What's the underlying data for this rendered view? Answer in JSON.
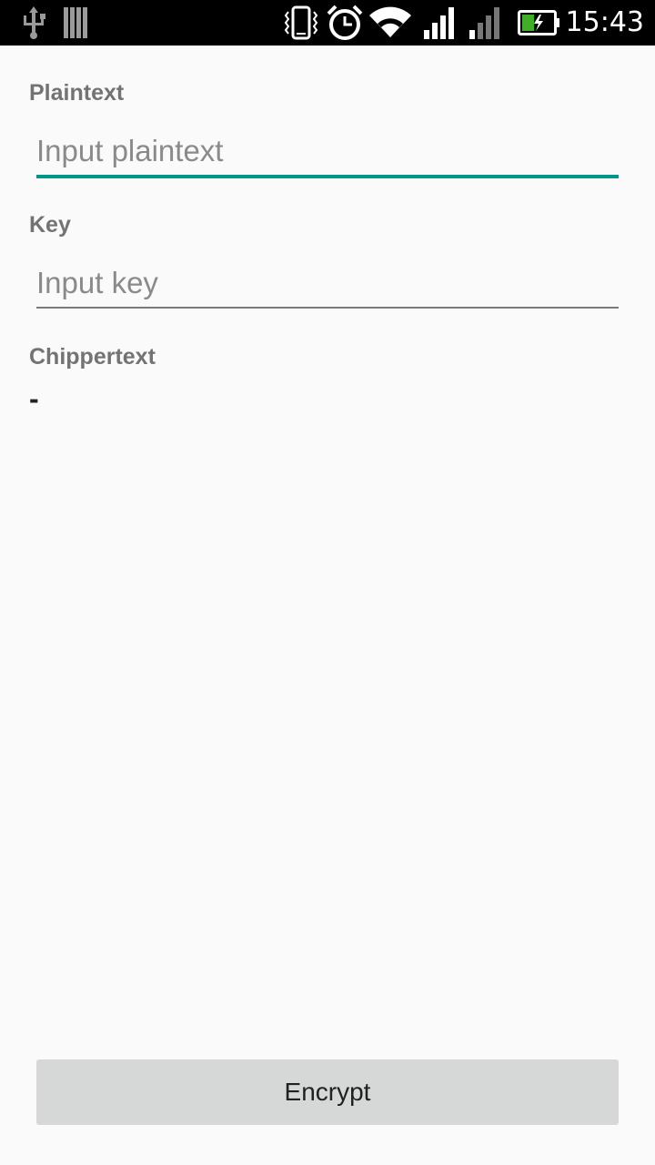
{
  "status_bar": {
    "time": "15:43",
    "icons": [
      "usb-icon",
      "storage-icon",
      "vibrate-icon",
      "alarm-icon",
      "wifi-icon",
      "signal-icon",
      "signal-icon",
      "battery-charging-icon"
    ]
  },
  "form": {
    "plaintext": {
      "label": "Plaintext",
      "placeholder": "Input plaintext",
      "value": ""
    },
    "key": {
      "label": "Key",
      "placeholder": "Input key",
      "value": ""
    },
    "ciphertext": {
      "label": "Chippertext",
      "value": "-"
    }
  },
  "actions": {
    "encrypt_label": "Encrypt"
  },
  "colors": {
    "accent": "#009688",
    "button_bg": "#d6d7d7",
    "background": "#fafafa",
    "label": "#737373"
  }
}
